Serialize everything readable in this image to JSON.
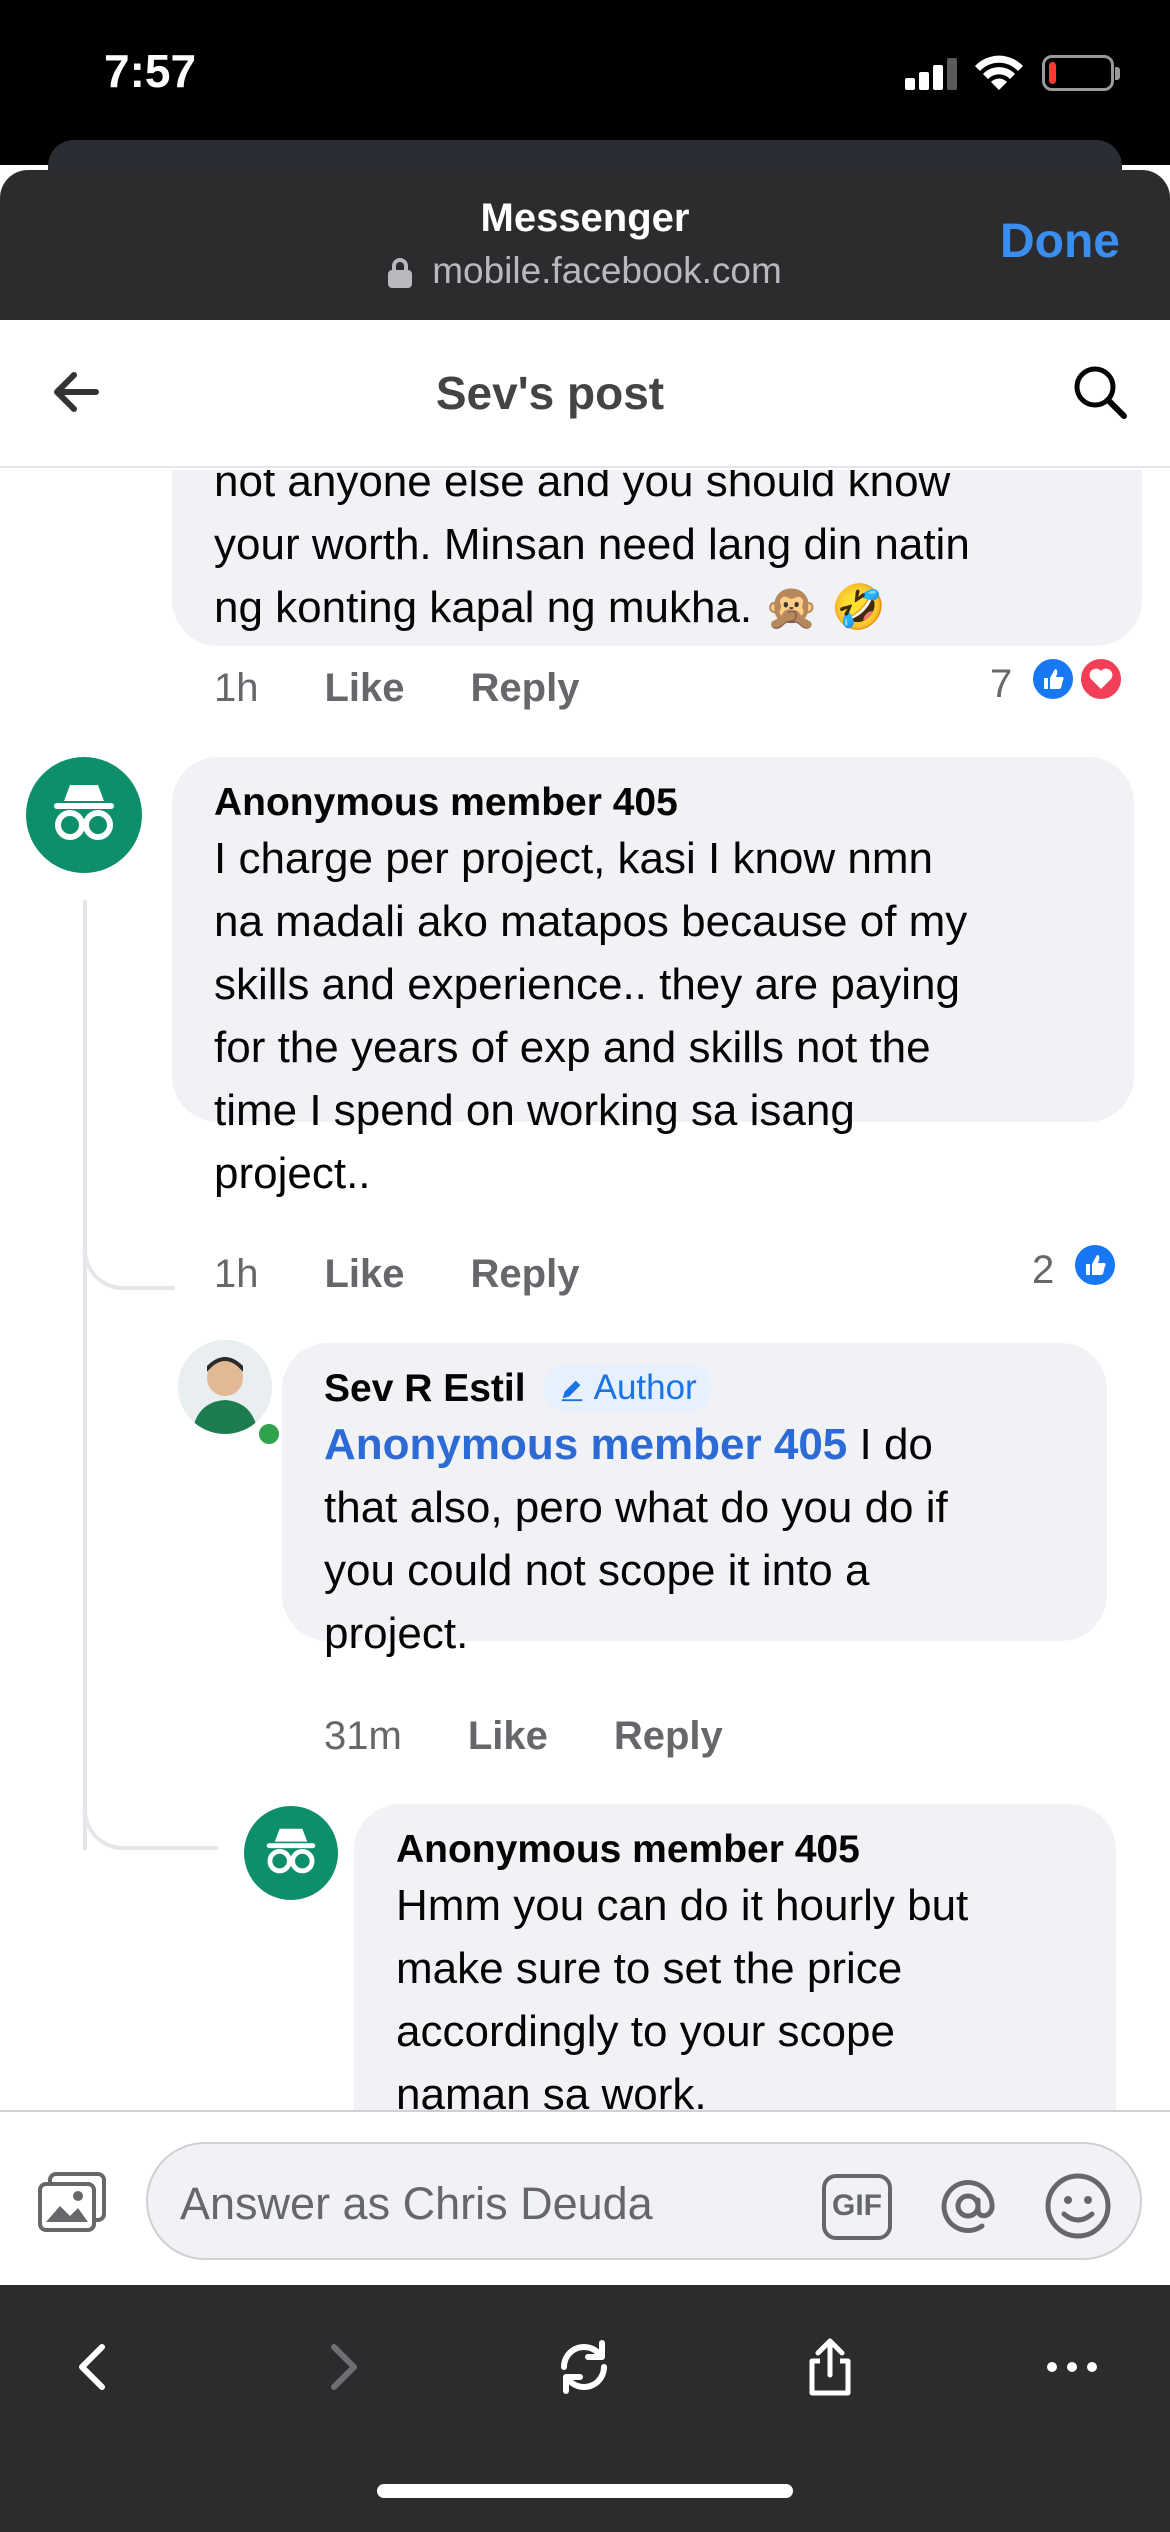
{
  "status_bar": {
    "time": "7:57",
    "battery_level": 0.12
  },
  "browser": {
    "title": "Messenger",
    "url": "mobile.facebook.com",
    "done_label": "Done"
  },
  "page": {
    "title": "Sev's post"
  },
  "comments": [
    {
      "text_line_partial": "not anyone else and you should know",
      "text_lines": [
        "your worth. Minsan need lang din natin",
        "ng konting kapal ng mukha. 🙊 🤣"
      ],
      "time": "1h",
      "like_label": "Like",
      "reply_label": "Reply",
      "reaction_count": "7",
      "reactions": [
        "like",
        "love"
      ]
    },
    {
      "author": "Anonymous member 405",
      "text_lines": [
        "I charge per project, kasi I know nmn",
        "na madali ako matapos because of my",
        "skills and experience.. they are paying",
        "for the years of exp and skills not the",
        "time I spend on working sa isang",
        "project.."
      ],
      "time": "1h",
      "like_label": "Like",
      "reply_label": "Reply",
      "reaction_count": "2",
      "reactions": [
        "like"
      ]
    },
    {
      "author": "Sev R Estil",
      "badge": "Author",
      "mention": "Anonymous member 405",
      "first_line_rest": " I do",
      "text_lines": [
        "that also, pero what do you do if",
        "you could not scope it into a",
        "project."
      ],
      "time": "31m",
      "like_label": "Like",
      "reply_label": "Reply"
    },
    {
      "author": "Anonymous member 405",
      "text_lines": [
        "Hmm you can do it hourly but",
        "make sure to set the price",
        "accordingly to your scope",
        "naman sa work."
      ]
    }
  ],
  "composer": {
    "placeholder": "Answer as Chris Deuda",
    "gif_label": "GIF"
  },
  "colors": {
    "anon_avatar": "#0e8f6b",
    "accent": "#1b74e4",
    "done": "#3a8eed",
    "bubble": "#f0f2f5"
  }
}
